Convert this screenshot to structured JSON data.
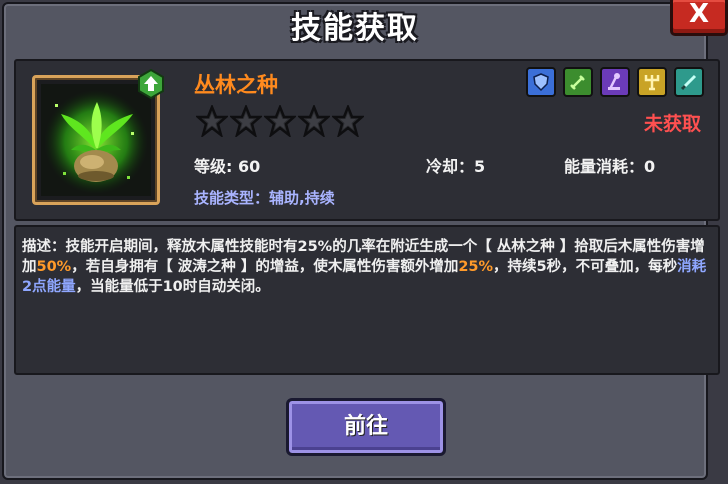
{
  "dialog": {
    "title": "技能获取",
    "close_label": "X"
  },
  "skill": {
    "name": "丛林之种",
    "status": "未获取",
    "star_count": 5,
    "stars_filled": 0,
    "level_label": "等级: 60",
    "cooldown_label": "冷却：5",
    "energy_label": "能量消耗：0",
    "type_prefix": "技能类型：",
    "type_value": "辅助,持续",
    "class_icons": [
      "shield-icon",
      "sword-icon",
      "staff-icon",
      "totem-icon",
      "blade-icon"
    ],
    "class_colors": [
      "#3b6fd8",
      "#3c8d2e",
      "#6b3bb8",
      "#c9a326",
      "#2e9a8c"
    ]
  },
  "description": {
    "seg1": "描述：技能开启期间，释放木属性技能时有25%的几率在附近生成一个【 丛林之种 】拾取后木属性伤害增加",
    "seg2": "50%",
    "seg3": "，若自身拥有【 波涛之种 】的增益，使木属性伤害额外增加",
    "seg4": "25%",
    "seg5": "，持续5秒，不可叠加，每秒",
    "seg6": "消耗2点能量",
    "seg7": "，当能量低于10时自动关闭。"
  },
  "actions": {
    "go_label": "前往"
  },
  "colors": {
    "accent_orange": "#ff8a1e",
    "status_red": "#ff5050",
    "type_blue": "#a9b4ff",
    "button_purple": "#6459b3"
  }
}
